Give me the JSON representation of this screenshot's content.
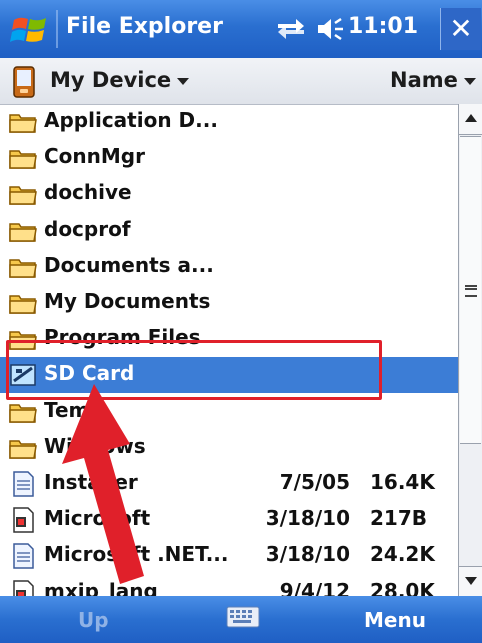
{
  "titlebar": {
    "app_title": "File Explorer",
    "clock": "11:01",
    "close_label": "✕"
  },
  "header": {
    "location": "My Device",
    "sort": "Name"
  },
  "files": [
    {
      "name": "Application D...",
      "type": "folder",
      "date": "",
      "size": ""
    },
    {
      "name": "ConnMgr",
      "type": "folder",
      "date": "",
      "size": ""
    },
    {
      "name": "dochive",
      "type": "folder",
      "date": "",
      "size": ""
    },
    {
      "name": "docprof",
      "type": "folder",
      "date": "",
      "size": ""
    },
    {
      "name": "Documents a...",
      "type": "folder",
      "date": "",
      "size": ""
    },
    {
      "name": "My Documents",
      "type": "folder",
      "date": "",
      "size": ""
    },
    {
      "name": "Program Files",
      "type": "folder",
      "date": "",
      "size": ""
    },
    {
      "name": "SD Card",
      "type": "storage-card",
      "date": "",
      "size": "",
      "selected": true
    },
    {
      "name": "Temp",
      "type": "folder",
      "date": "",
      "size": ""
    },
    {
      "name": "Windows",
      "type": "folder",
      "date": "",
      "size": ""
    },
    {
      "name": "Installer",
      "type": "document",
      "date": "7/5/05",
      "size": "16.4K"
    },
    {
      "name": "Microsoft",
      "type": "shortcut",
      "date": "3/18/10",
      "size": "217B"
    },
    {
      "name": "Microsoft .NET...",
      "type": "document",
      "date": "3/18/10",
      "size": "24.2K"
    },
    {
      "name": "mxip_lang",
      "type": "shortcut",
      "date": "9/4/12",
      "size": "28.0K"
    }
  ],
  "softkeys": {
    "left": "Up",
    "right": "Menu"
  },
  "colors": {
    "titlebar": "#2a6fd0",
    "selection": "#3c7dd6",
    "annotation": "#e0202a"
  }
}
